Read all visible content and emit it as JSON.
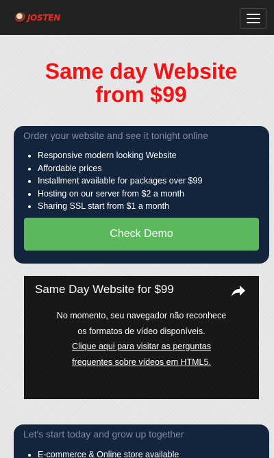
{
  "navbar": {
    "logo_text": "JOSTEN",
    "menu_icon": "hamburger-menu-icon"
  },
  "headline": {
    "line1": "Same day Website",
    "line2": "from $99"
  },
  "offer_panel": {
    "subtitle": "Order your website and see it tonight online",
    "items": [
      "Responsive modern looking Website",
      "Affordable prices",
      "Installment available for packages over $99",
      "Hosting on our server from $2 a month",
      "Sharing SSL start from $1 a month"
    ],
    "cta_label": "Check Demo"
  },
  "video": {
    "title": "Same Day Website for $99",
    "share_icon": "share-arrow-icon",
    "message_line1": "No momento, seu navegador não reconhece",
    "message_line2": "os formatos de vídeo disponíveis.",
    "link_line1": "Clique aqui para visitar as perguntas",
    "link_line2": "frequentes sobre vídeos em HTML5."
  },
  "growth_panel": {
    "subtitle": "Let's start today and grow up together",
    "items": [
      "E-commerce & Online store available"
    ]
  },
  "colors": {
    "headline": "#f01414",
    "panel_bg": "#13243d",
    "cta_bg": "#5cb85c",
    "navbar_bg": "#222222"
  }
}
